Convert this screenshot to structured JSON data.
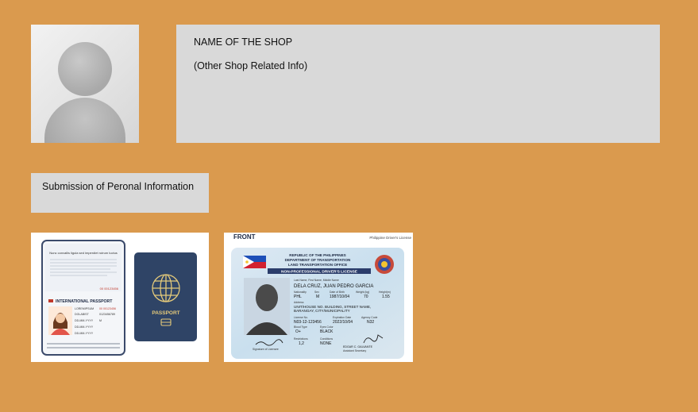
{
  "profile": {
    "avatar_icon": "user-avatar-placeholder-icon"
  },
  "shop": {
    "name": "NAME OF THE SHOP",
    "info": "(Other Shop Related Info)"
  },
  "submission": {
    "button_label": "Submission of Peronal Information"
  },
  "documents": {
    "passport": {
      "header": "Nunc convallis ligula sed imperdiet rutrum luctus",
      "title": "INTERNATIONAL PASSPORT",
      "cover_label": "PASSPORT",
      "number": "00 00123456",
      "fields": [
        "LOREMIPSUM",
        "DOLABIST",
        "DD-MM-YYYY",
        "DD-MM-YYYY",
        "DD-MM-YYYY"
      ],
      "extra": [
        "00 00123456",
        "0123456789",
        "M"
      ]
    },
    "license": {
      "side": "FRONT",
      "top_right": "Philippine Driver's License",
      "republic": "REPUBLIC OF THE PHILIPPINES",
      "department": "DEPARTMENT OF TRANSPORTATION",
      "office": "LAND TRANSPORTATION OFFICE",
      "type": "NON-PROFESSIONAL DRIVER'S LICENSE",
      "name_label": "Last Name, First Name, Middle Name",
      "name": "DELA CRUZ, JUAN PEDRO GARCIA",
      "nationality_label": "Nationality",
      "nationality": "PHL",
      "sex_label": "Sex",
      "sex": "M",
      "dob_label": "Date of Birth",
      "dob": "1987/10/04",
      "weight_label": "Weight (kg)",
      "weight": "70",
      "height_label": "Height(m)",
      "height": "1.55",
      "address_label": "Address",
      "address_1": "UNIT/HOUSE NO. BUILDING, STREET NAME,",
      "address_2": "BARANGAY, CITY/MUNICIPALITY",
      "license_no_label": "License No.",
      "license_no": "N03-12-123456",
      "expiry_label": "Expiration Date",
      "expiry": "2022/10/04",
      "agency_label": "Agency Code",
      "agency": "N32",
      "blood_label": "Blood Type",
      "blood": "O+",
      "eyes_label": "Eyes Color",
      "eyes": "BLACK",
      "restrictions_label": "Restrictions",
      "restrictions": "1,2",
      "conditions_label": "Conditions",
      "conditions": "NONE",
      "signature_label": "Signature of Licensee",
      "official": "EDGAR C. GALVANTE",
      "official_title": "Assistant Secretary"
    }
  }
}
